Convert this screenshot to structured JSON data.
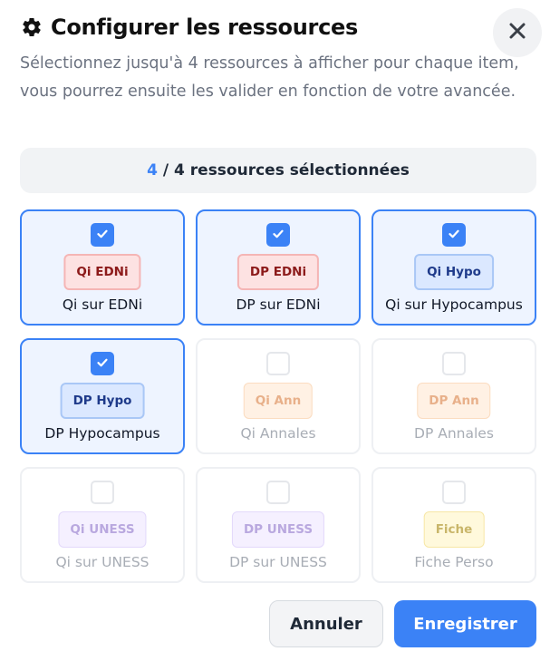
{
  "dialog": {
    "title": "Configurer les ressources",
    "subtitle": "Sélectionnez jusqu'à 4 ressources à afficher pour chaque item, vous pourrez ensuite les valider en fonction de votre avancée.",
    "close_icon": "close-icon",
    "settings_icon": "gear-icon"
  },
  "counter": {
    "selected": "4",
    "rest": " / 4 ressources sélectionnées"
  },
  "resources": [
    {
      "badge": "Qi EDNi",
      "label": "Qi sur EDNi",
      "selected": true,
      "kind": "edni"
    },
    {
      "badge": "DP EDNi",
      "label": "DP sur EDNi",
      "selected": true,
      "kind": "edni"
    },
    {
      "badge": "Qi Hypo",
      "label": "Qi sur Hypocampus",
      "selected": true,
      "kind": "hypo"
    },
    {
      "badge": "DP Hypo",
      "label": "DP Hypocampus",
      "selected": true,
      "kind": "hypo"
    },
    {
      "badge": "Qi Ann",
      "label": "Qi Annales",
      "selected": false,
      "kind": "ann"
    },
    {
      "badge": "DP Ann",
      "label": "DP Annales",
      "selected": false,
      "kind": "ann"
    },
    {
      "badge": "Qi UNESS",
      "label": "Qi sur UNESS",
      "selected": false,
      "kind": "uness"
    },
    {
      "badge": "DP UNESS",
      "label": "DP sur UNESS",
      "selected": false,
      "kind": "uness"
    },
    {
      "badge": "Fiche",
      "label": "Fiche Perso",
      "selected": false,
      "kind": "fiche"
    }
  ],
  "actions": {
    "cancel_label": "Annuler",
    "save_label": "Enregistrer"
  },
  "colors": {
    "accent": "#3b82f6",
    "selected_bg": "#eef4ff",
    "edni": "#fde2e2",
    "hypo": "#dbe8ff",
    "annales": "#fff1e4",
    "uness": "#f5f0ff",
    "fiche": "#fff9dc"
  }
}
